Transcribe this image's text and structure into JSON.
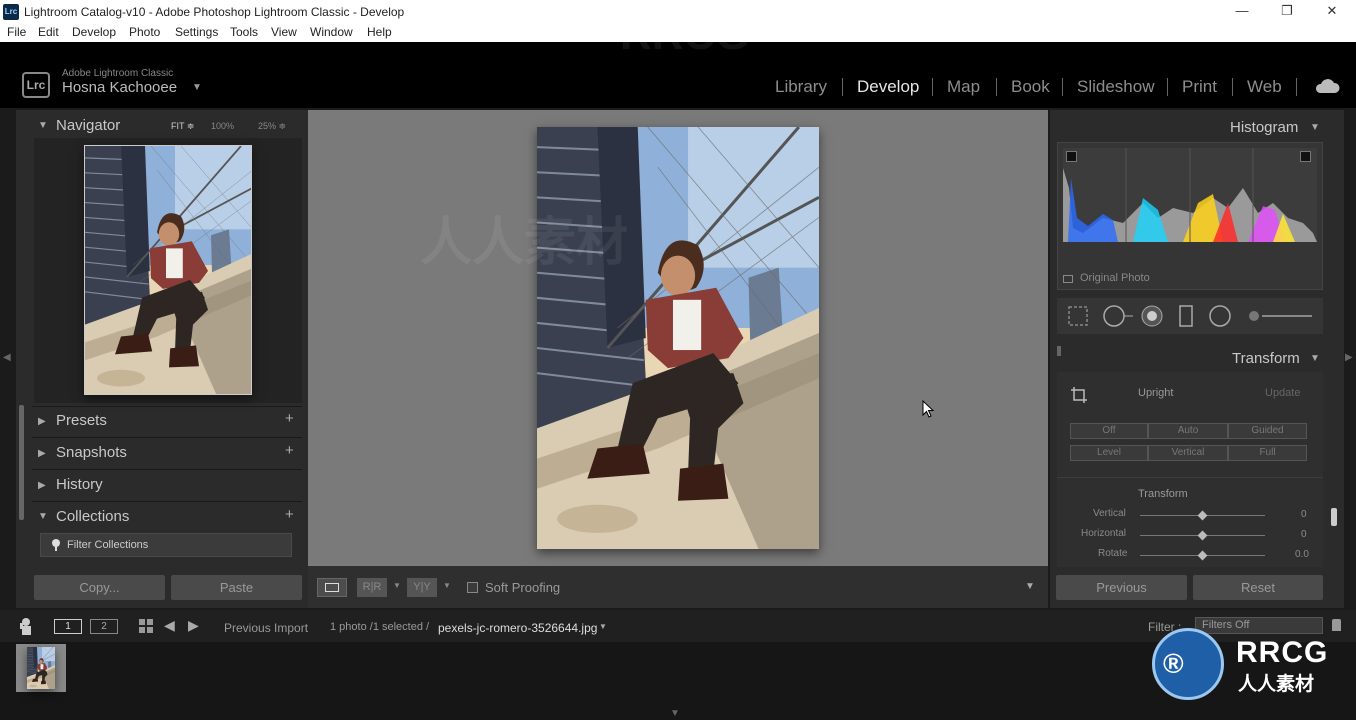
{
  "window": {
    "title": "Lightroom Catalog-v10 - Adobe Photoshop Lightroom Classic - Develop",
    "app_badge": "Lrc",
    "controls": [
      "—",
      "❐",
      "✕"
    ]
  },
  "menu": [
    "File",
    "Edit",
    "Develop",
    "Photo",
    "Settings",
    "Tools",
    "View",
    "Window",
    "Help"
  ],
  "identity": {
    "product": "Adobe Lightroom Classic",
    "user": "Hosna Kachooee",
    "logo": "Lrc"
  },
  "modules": [
    {
      "label": "Library",
      "active": false
    },
    {
      "label": "Develop",
      "active": true
    },
    {
      "label": "Map",
      "active": false
    },
    {
      "label": "Book",
      "active": false
    },
    {
      "label": "Slideshow",
      "active": false
    },
    {
      "label": "Print",
      "active": false
    },
    {
      "label": "Web",
      "active": false
    }
  ],
  "left_panel": {
    "navigator": {
      "title": "Navigator",
      "fit": "FIT ≑",
      "zoom1": "100%",
      "zoom2": "25% ≑"
    },
    "presets": "Presets",
    "snapshots": "Snapshots",
    "history": "History",
    "collections": "Collections",
    "filter_collections": "Filter Collections",
    "copy": "Copy...",
    "paste": "Paste"
  },
  "toolbar": {
    "view_ba1": "R|R",
    "view_ba2": "Y|Y",
    "soft_proofing": "Soft Proofing"
  },
  "right_panel": {
    "histogram": "Histogram",
    "original_photo": "Original Photo",
    "transform_header": "Transform",
    "upright": "Upright",
    "update": "Update",
    "upright_buttons": [
      "Off",
      "Auto",
      "Guided",
      "Level",
      "Vertical",
      "Full"
    ],
    "transform_sub": "Transform",
    "sliders": [
      {
        "label": "Vertical",
        "value": "0"
      },
      {
        "label": "Horizontal",
        "value": "0"
      },
      {
        "label": "Rotate",
        "value": "0.0"
      }
    ],
    "previous": "Previous",
    "reset": "Reset"
  },
  "filmstrip": {
    "page1": "1",
    "page2": "2",
    "source": "Previous Import",
    "count": "1 photo /1 selected /",
    "filename": "pexels-jc-romero-3526644.jpg",
    "filter_label": "Filter :",
    "filter_value": "Filters Off"
  },
  "watermark": {
    "brand": "RRCG",
    "cn": "人人素材"
  },
  "colors": {
    "accent_active": "#e6e6e6",
    "panel": "#2b2b2b",
    "canvas": "#7a7a7a"
  }
}
